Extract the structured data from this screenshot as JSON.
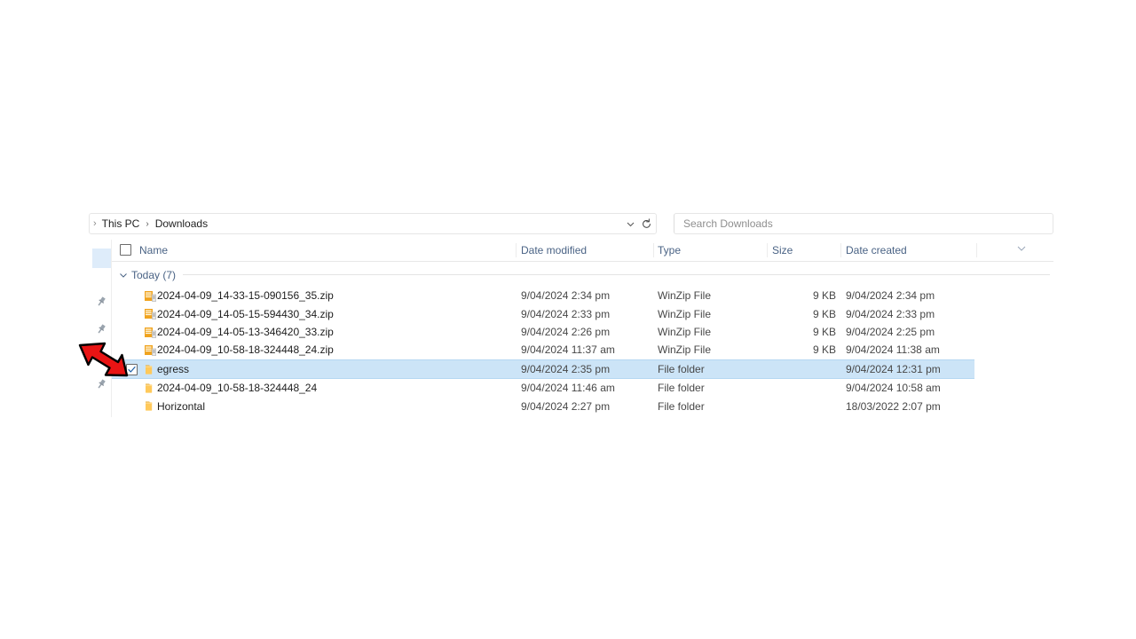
{
  "window": {
    "app": "File Explorer"
  },
  "breadcrumb": {
    "leading_chevron": "chevron-right-small",
    "items": [
      "This PC",
      "Downloads"
    ],
    "separator": "›",
    "dropdown_icon": "chevron-down-icon",
    "refresh_icon": "refresh-icon"
  },
  "search": {
    "placeholder": "Search Downloads",
    "value": ""
  },
  "nav_pane": {
    "pin_icon": "pin-icon",
    "pin_count": 4
  },
  "columns": [
    {
      "key": "name",
      "label": "Name"
    },
    {
      "key": "date_modified",
      "label": "Date modified"
    },
    {
      "key": "type",
      "label": "Type"
    },
    {
      "key": "size",
      "label": "Size"
    },
    {
      "key": "date_created",
      "label": "Date created",
      "sorted": true,
      "sort_icon": "chevron-down-icon"
    }
  ],
  "group": {
    "label": "Today (7)",
    "expanded": true,
    "chevron_icon": "chevron-down-icon"
  },
  "files": [
    {
      "name": "2024-04-09_14-33-15-090156_35.zip",
      "date_modified": "9/04/2024 2:34 pm",
      "type": "WinZip File",
      "size": "9 KB",
      "date_created": "9/04/2024 2:34 pm",
      "icon": "zip-file-icon",
      "selected": false
    },
    {
      "name": "2024-04-09_14-05-15-594430_34.zip",
      "date_modified": "9/04/2024 2:33 pm",
      "type": "WinZip File",
      "size": "9 KB",
      "date_created": "9/04/2024 2:33 pm",
      "icon": "zip-file-icon",
      "selected": false
    },
    {
      "name": "2024-04-09_14-05-13-346420_33.zip",
      "date_modified": "9/04/2024 2:26 pm",
      "type": "WinZip File",
      "size": "9 KB",
      "date_created": "9/04/2024 2:25 pm",
      "icon": "zip-file-icon",
      "selected": false
    },
    {
      "name": "2024-04-09_10-58-18-324448_24.zip",
      "date_modified": "9/04/2024 11:37 am",
      "type": "WinZip File",
      "size": "9 KB",
      "date_created": "9/04/2024 11:38 am",
      "icon": "zip-file-icon",
      "selected": false
    },
    {
      "name": "egress",
      "date_modified": "9/04/2024 2:35 pm",
      "type": "File folder",
      "size": "",
      "date_created": "9/04/2024 12:31 pm",
      "icon": "folder-icon",
      "selected": true
    },
    {
      "name": "2024-04-09_10-58-18-324448_24",
      "date_modified": "9/04/2024 11:46 am",
      "type": "File folder",
      "size": "",
      "date_created": "9/04/2024 10:58 am",
      "icon": "folder-icon",
      "selected": false
    },
    {
      "name": "Horizontal",
      "date_modified": "9/04/2024 2:27 pm",
      "type": "File folder",
      "size": "",
      "date_created": "18/03/2022 2:07 pm",
      "icon": "folder-icon",
      "selected": false
    }
  ],
  "annotation": {
    "arrow_icon": "red-arrow-pointing-down-right",
    "color": "#e81414",
    "target": "egress row checkbox"
  },
  "colors": {
    "selection": "#cce4f7",
    "header_text": "#4a6385",
    "folder": "#ffc95b",
    "zip": "#f0a31e",
    "annotation_red": "#e81414"
  }
}
